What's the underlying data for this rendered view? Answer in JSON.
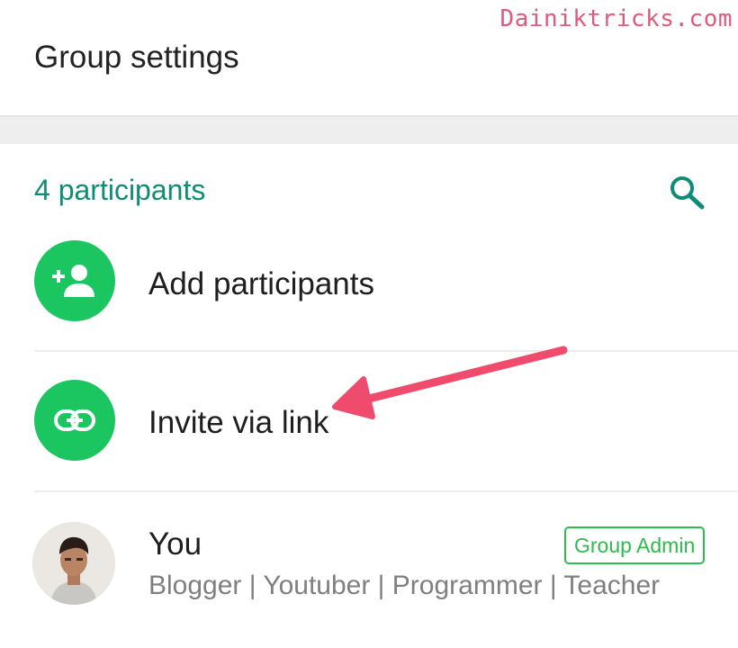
{
  "watermark": "Dainiktricks.com",
  "header": {
    "title": "Group settings"
  },
  "participants": {
    "count_label": "4 participants",
    "search_icon": "search-icon"
  },
  "actions": [
    {
      "label": "Add participants",
      "icon": "add-person-icon"
    },
    {
      "label": "Invite via link",
      "icon": "link-icon"
    }
  ],
  "members": [
    {
      "name": "You",
      "status": "Blogger | Youtuber | Programmer | Teacher",
      "badge": "Group Admin"
    }
  ],
  "colors": {
    "accent_green": "#1bc55f",
    "teal_text": "#0f8c75",
    "badge_green": "#2dbb4e",
    "annotation_arrow": "#ef4b6c",
    "watermark": "#e05a7c"
  }
}
